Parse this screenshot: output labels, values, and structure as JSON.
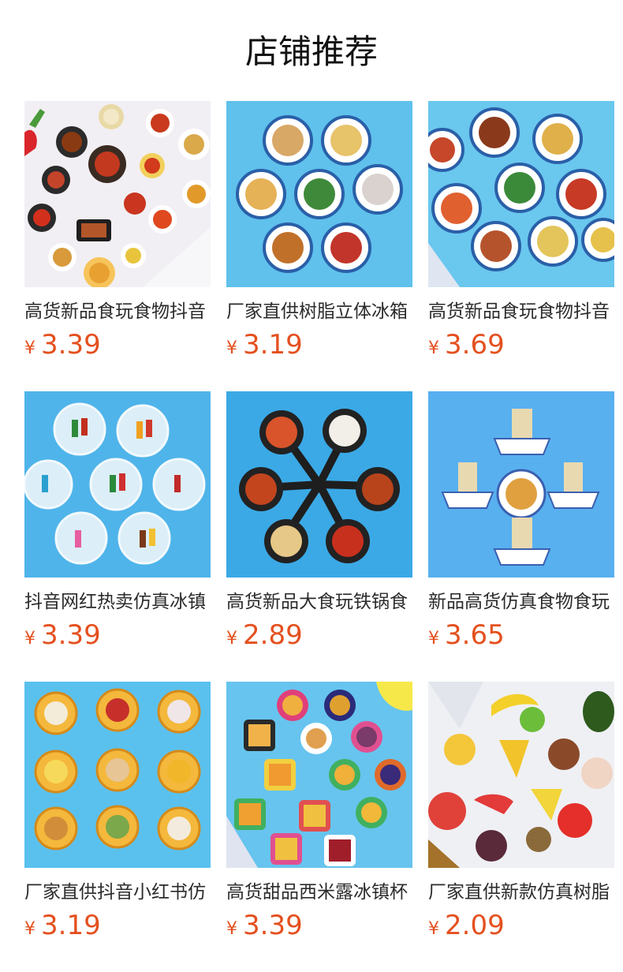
{
  "page": {
    "title": "店铺推荐"
  },
  "products": [
    {
      "name": "高货新品食玩食物抖音",
      "currency": "¥",
      "price": "3.39",
      "bg": "#f1eff3",
      "image": "food-dishes-photo"
    },
    {
      "name": "厂家直供树脂立体冰箱",
      "currency": "¥",
      "price": "3.19",
      "bg": "#5fc1ec",
      "image": "plate-magnets-photo"
    },
    {
      "name": "高货新品食玩食物抖音",
      "currency": "¥",
      "price": "3.69",
      "bg": "#6ac7ee",
      "image": "plate-magnets-photo"
    },
    {
      "name": "抖音网红热卖仿真冰镇",
      "currency": "¥",
      "price": "3.39",
      "bg": "#4fb4ea",
      "image": "ice-drinks-photo"
    },
    {
      "name": "高货新品大食玩铁锅食",
      "currency": "¥",
      "price": "2.89",
      "bg": "#3ba9e6",
      "image": "iron-pan-photo"
    },
    {
      "name": "新品高货仿真食物食玩",
      "currency": "¥",
      "price": "3.65",
      "bg": "#58b0ef",
      "image": "noodle-bowls-photo"
    },
    {
      "name": "厂家直供抖音小红书仿",
      "currency": "¥",
      "price": "3.19",
      "bg": "#5ac1ee",
      "image": "steamer-baskets-photo"
    },
    {
      "name": "高货甜品西米露冰镇杯",
      "currency": "¥",
      "price": "3.39",
      "bg": "#67c4ee",
      "image": "dessert-cups-photo"
    },
    {
      "name": "厂家直供新款仿真树脂",
      "currency": "¥",
      "price": "2.09",
      "bg": "#eff0f4",
      "image": "fruit-magnets-photo"
    }
  ]
}
